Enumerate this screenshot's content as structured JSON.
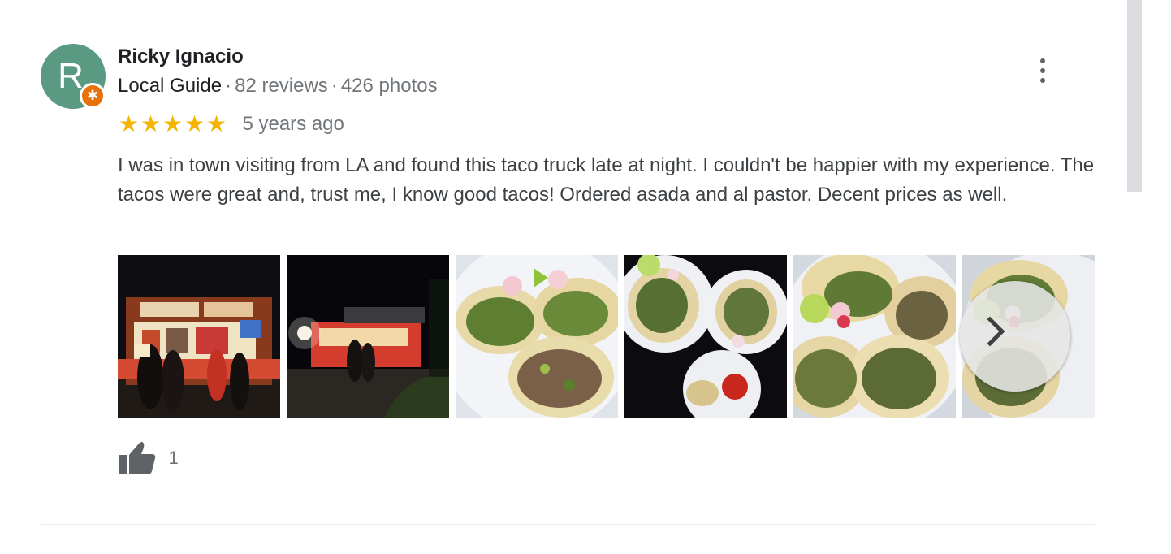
{
  "review": {
    "avatar_letter": "R",
    "badge_icon": "local-guide-star-icon",
    "author": "Ricky Ignacio",
    "guide_label": "Local Guide",
    "separator": "·",
    "reviews_count": "82 reviews",
    "photos_count": "426 photos",
    "rating": 5,
    "rating_max": 5,
    "date": "5 years ago",
    "text": "I was in town visiting from LA and found this taco truck late at night. I couldn't be happier with my experience. The tacos were great and, trust me, I know good tacos! Ordered asada and al pastor. Decent prices as well.",
    "likes": "1"
  },
  "photos": [
    {
      "name": "photo-taco-truck-front"
    },
    {
      "name": "photo-taco-truck-night"
    },
    {
      "name": "photo-tacos-plate"
    },
    {
      "name": "photo-tacos-plates-salsa"
    },
    {
      "name": "photo-tacos-closeup"
    },
    {
      "name": "photo-tacos-partial"
    }
  ],
  "colors": {
    "avatar": "#5b9a82",
    "badge": "#e8710a",
    "star": "#f4b400",
    "muted_text": "#70757a",
    "body_text": "#3c4043"
  }
}
